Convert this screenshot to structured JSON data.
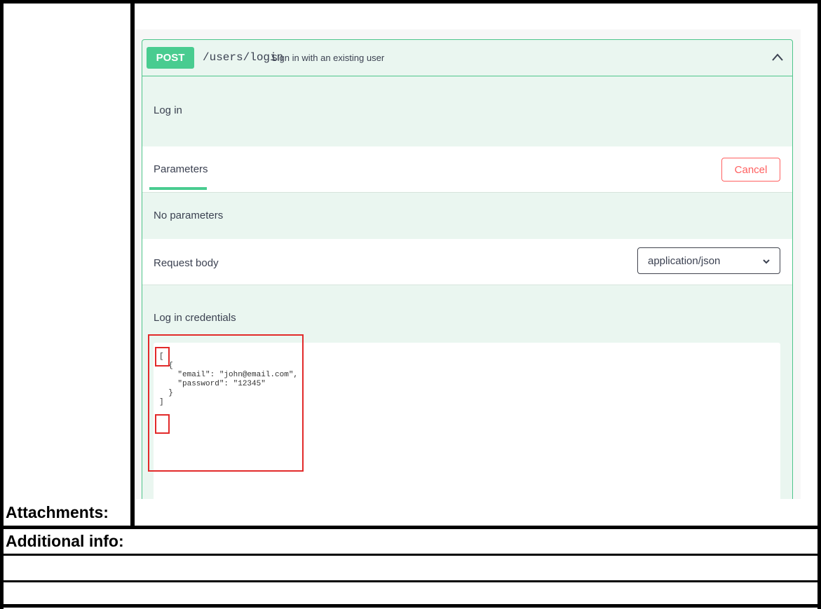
{
  "operation": {
    "method": "POST",
    "path": "/users/login",
    "summary": "Sign in with an existing user",
    "description": "Log in",
    "parameters_tab": "Parameters",
    "cancel_label": "Cancel",
    "no_parameters": "No parameters",
    "request_body_label": "Request body",
    "content_type": "application/json",
    "body_description": "Log in credentials",
    "example_code": "[\n  {\n    \"email\": \"john@email.com\",\n    \"password\": \"12345\"\n  }\n]"
  },
  "table": {
    "attachments_label": "Attachments:",
    "additional_info_label": "Additional info:"
  },
  "colors": {
    "post_method": "#49cc90",
    "op_border": "#4ec68b",
    "op_background": "#eaf6f0",
    "cancel": "#ff6060",
    "highlight": "#e22a2a"
  },
  "icons": [
    "chevron-up-icon",
    "chevron-down-icon"
  ]
}
